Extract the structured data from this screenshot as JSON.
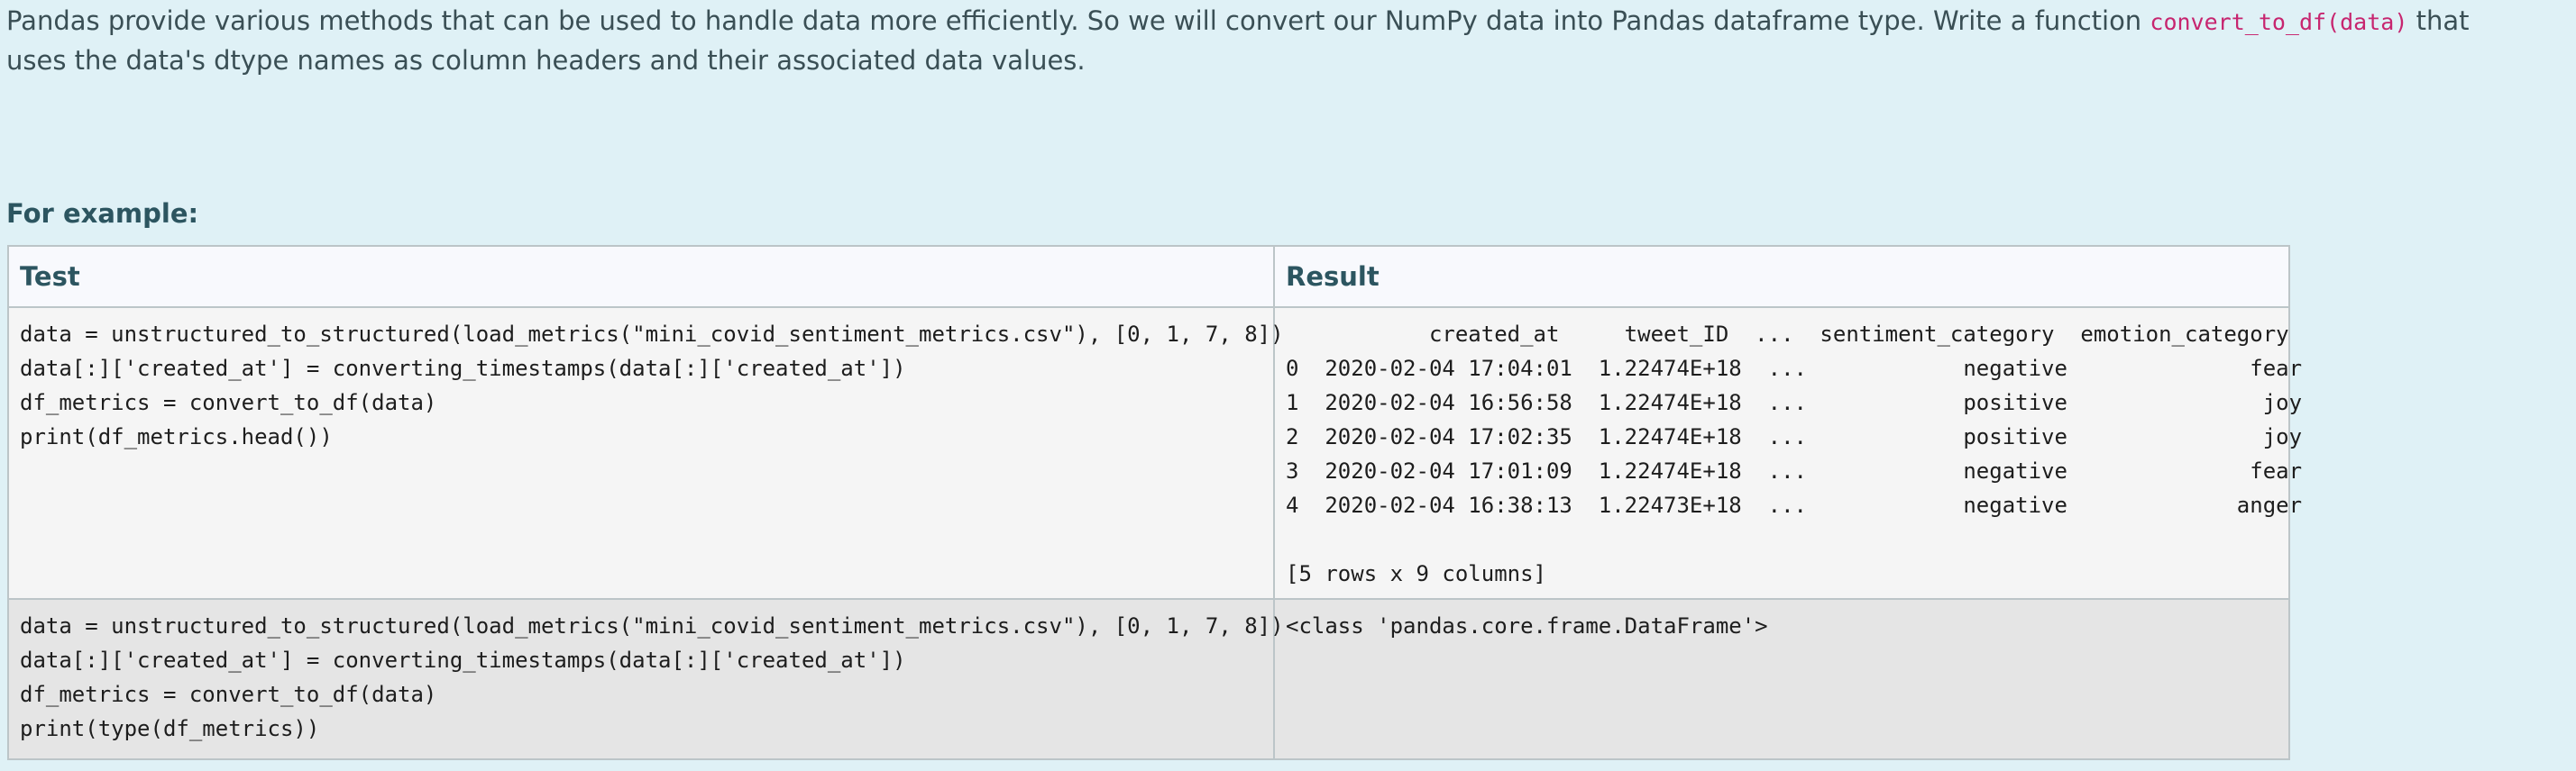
{
  "intro": {
    "text_before": "Pandas provide various methods that can be used to handle data more efficiently. So we will convert our NumPy data into Pandas dataframe type. Write a function ",
    "code": "convert_to_df(data)",
    "text_after": " that uses the data's dtype names as column headers and their associated data values."
  },
  "for_example_label": "For example:",
  "table": {
    "headers": {
      "test": "Test",
      "result": "Result"
    },
    "rows": [
      {
        "test": "data = unstructured_to_structured(load_metrics(\"mini_covid_sentiment_metrics.csv\"), [0, 1, 7, 8])\ndata[:]['created_at'] = converting_timestamps(data[:]['created_at'])\ndf_metrics = convert_to_df(data)\nprint(df_metrics.head())",
        "result": "           created_at     tweet_ID  ...  sentiment_category  emotion_category\n0  2020-02-04 17:04:01  1.22474E+18  ...            negative              fear\n1  2020-02-04 16:56:58  1.22474E+18  ...            positive               joy\n2  2020-02-04 17:02:35  1.22474E+18  ...            positive               joy\n3  2020-02-04 17:01:09  1.22474E+18  ...            negative              fear\n4  2020-02-04 16:38:13  1.22473E+18  ...            negative             anger\n\n[5 rows x 9 columns]"
      },
      {
        "test": "data = unstructured_to_structured(load_metrics(\"mini_covid_sentiment_metrics.csv\"), [0, 1, 7, 8])\ndata[:]['created_at'] = converting_timestamps(data[:]['created_at'])\ndf_metrics = convert_to_df(data)\nprint(type(df_metrics))",
        "result": "<class 'pandas.core.frame.DataFrame'>"
      }
    ]
  }
}
